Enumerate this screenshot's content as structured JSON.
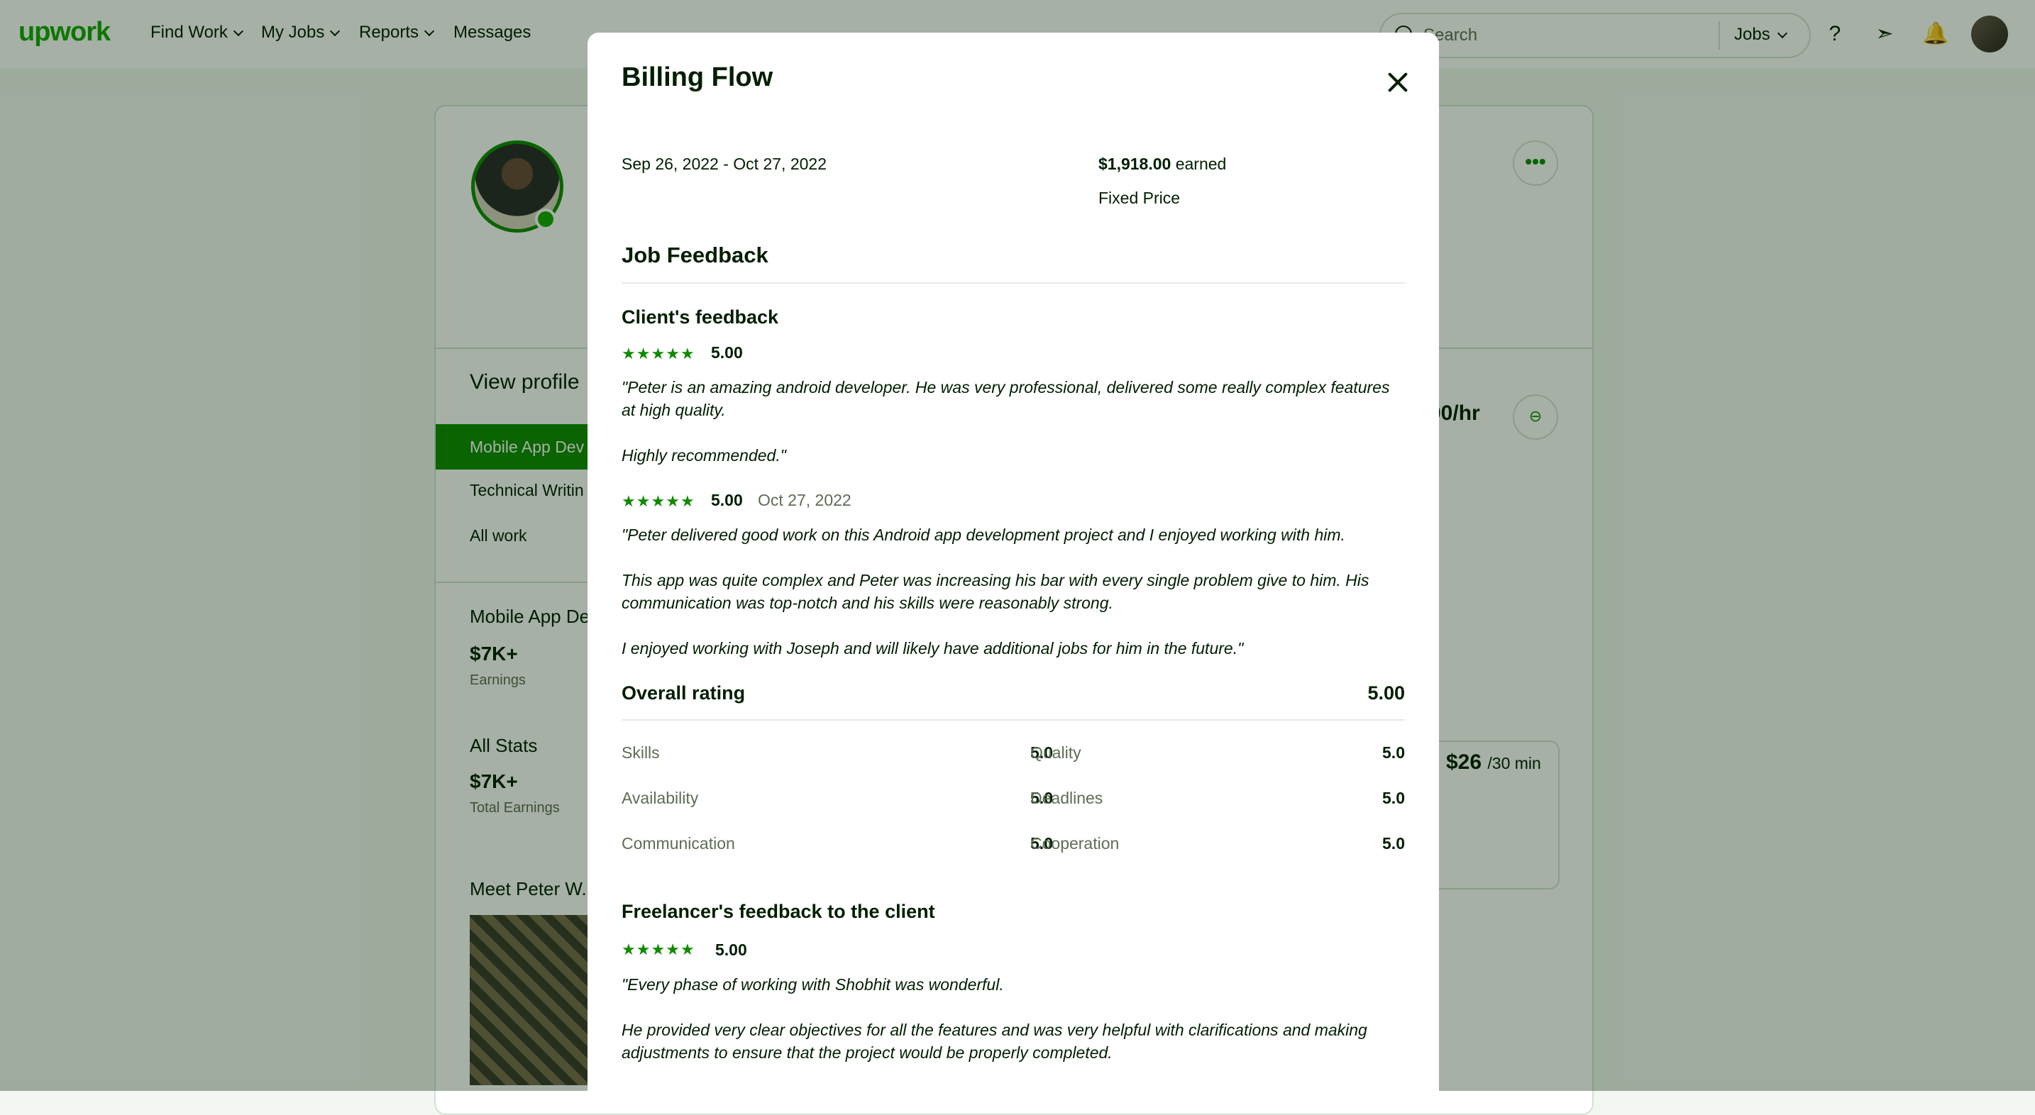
{
  "nav": {
    "logo": "upwork",
    "items": [
      {
        "label": "Find Work"
      },
      {
        "label": "My Jobs"
      },
      {
        "label": "Reports"
      },
      {
        "label": "Messages"
      }
    ],
    "search_placeholder": "Search",
    "search_scope": "Jobs"
  },
  "profile": {
    "view_profile": "View profile",
    "specialized": [
      "Mobile App Dev",
      "Technical Writin",
      "All work"
    ],
    "section_mobile": "Mobile App De",
    "mobile_earnings": "$7K+",
    "mobile_earnings_label": "Earnings",
    "all_stats": "All Stats",
    "total_earnings": "$7K+",
    "total_earnings_label": "Total Earnings",
    "meet": "Meet Peter W.",
    "rate": "00/hr",
    "consult_price": "$26",
    "consult_unit": "/30 min"
  },
  "modal": {
    "title": "Billing Flow",
    "date_range": "Sep 26, 2022 - Oct 27, 2022",
    "earned_amount": "$1,918.00",
    "earned_suffix": "earned",
    "contract_type": "Fixed Price",
    "job_feedback_heading": "Job Feedback",
    "client_feedback_heading": "Client's feedback",
    "client_reviews": [
      {
        "rating": "5.00",
        "date": "",
        "paragraphs": [
          "\"Peter is an amazing android developer. He was very professional, delivered some really complex features at high quality.",
          "Highly recommended.\""
        ]
      },
      {
        "rating": "5.00",
        "date": "Oct 27, 2022",
        "paragraphs": [
          "\"Peter delivered good work on this Android app development project and I enjoyed working with him.",
          "This app was quite complex and Peter was increasing his bar with every single problem give to him. His communication was top-notch and his skills were reasonably strong.",
          "I enjoyed working with Joseph and will likely have additional jobs for him in the future.\""
        ]
      }
    ],
    "overall_label": "Overall rating",
    "overall_value": "5.00",
    "sub_ratings": [
      {
        "label": "Skills",
        "value": "5.0"
      },
      {
        "label": "Quality",
        "value": "5.0"
      },
      {
        "label": "Availability",
        "value": "5.0"
      },
      {
        "label": "Deadlines",
        "value": "5.0"
      },
      {
        "label": "Communication",
        "value": "5.0"
      },
      {
        "label": "Cooperation",
        "value": "5.0"
      }
    ],
    "freelancer_heading": "Freelancer's feedback to the client",
    "freelancer_rating": "5.00",
    "freelancer_paragraphs": [
      "\"Every phase of working with Shobhit was wonderful.",
      "He provided very clear objectives for all the features and was very helpful with clarifications and making adjustments to ensure that the project would be properly completed."
    ],
    "star_count": 5,
    "accent_color": "#108a00"
  }
}
